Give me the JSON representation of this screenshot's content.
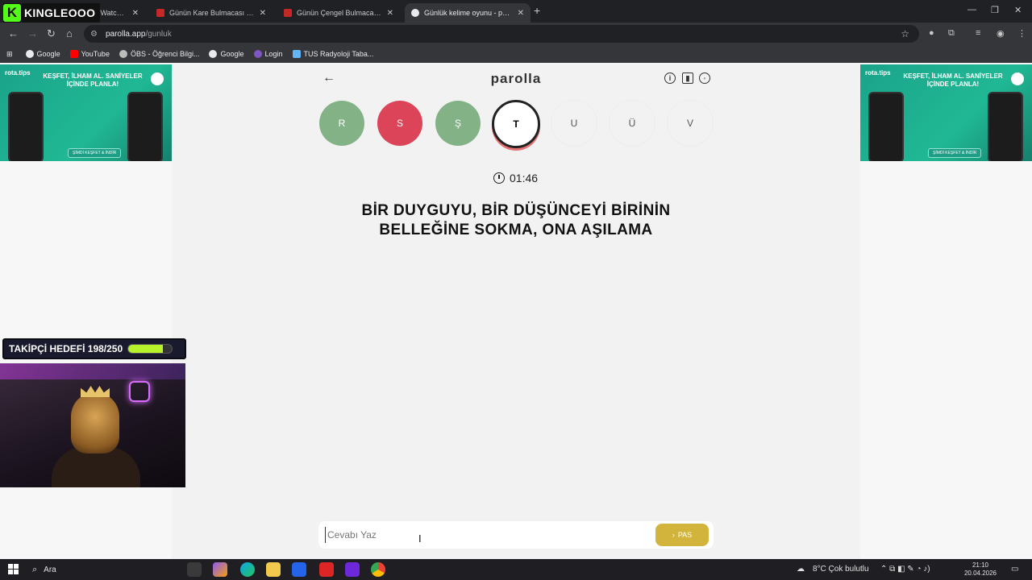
{
  "streamer": {
    "name": "KINGLEOOO",
    "logo_letter": "K"
  },
  "browser": {
    "tabs": [
      {
        "title": "am - Watch Li",
        "active": false
      },
      {
        "title": "Günün Kare Bulmacası | HT Bul",
        "active": false
      },
      {
        "title": "Günün Çengel Bulmacası| HT B",
        "active": false
      },
      {
        "title": "Günlük kelime oyunu - parolla",
        "active": true
      }
    ],
    "new_tab": "+",
    "url_host": "parolla.app",
    "url_path": "/gunluk",
    "bookmarks": [
      "Google",
      "YouTube",
      "ÖBS - Öğrenci Bilgi...",
      "Google",
      "Login",
      "TUS Radyoloji Taba..."
    ]
  },
  "ads": {
    "brand": "rota.tips",
    "headline": "KEŞFET, İLHAM AL. SANİYELER İÇİNDE PLANLA!",
    "cta": "ŞİMDİ KEŞFET & İNDİR"
  },
  "game": {
    "logo": "parolla",
    "letters": [
      {
        "label": "R",
        "state": "correct"
      },
      {
        "label": "S",
        "state": "wrong"
      },
      {
        "label": "Ş",
        "state": "correct"
      },
      {
        "label": "T",
        "state": "current"
      },
      {
        "label": "U",
        "state": "pending"
      },
      {
        "label": "Ü",
        "state": "pending"
      },
      {
        "label": "V",
        "state": "pending"
      }
    ],
    "timer": "01:46",
    "question_line1": "BİR DUYGUYU, BİR DÜŞÜNCEYİ BİRİNİN",
    "question_line2": "BELLEĞİNE SOKMA, ONA AŞILAMA",
    "answer_placeholder": "Cevabı Yaz",
    "pass_label": "PAS"
  },
  "overlay": {
    "goal_label": "TAKİPÇİ HEDEFİ 198/250",
    "goal_progress": 0.792
  },
  "taskbar": {
    "search_label": "Ara",
    "weather": "8°C  Çok bulutlu",
    "time": "21:10",
    "date": "20.04.2026"
  },
  "colors": {
    "correct": "#83b286",
    "wrong": "#dc4459",
    "pass": "#d2b43c",
    "goal_fill": "#b7f22b"
  }
}
